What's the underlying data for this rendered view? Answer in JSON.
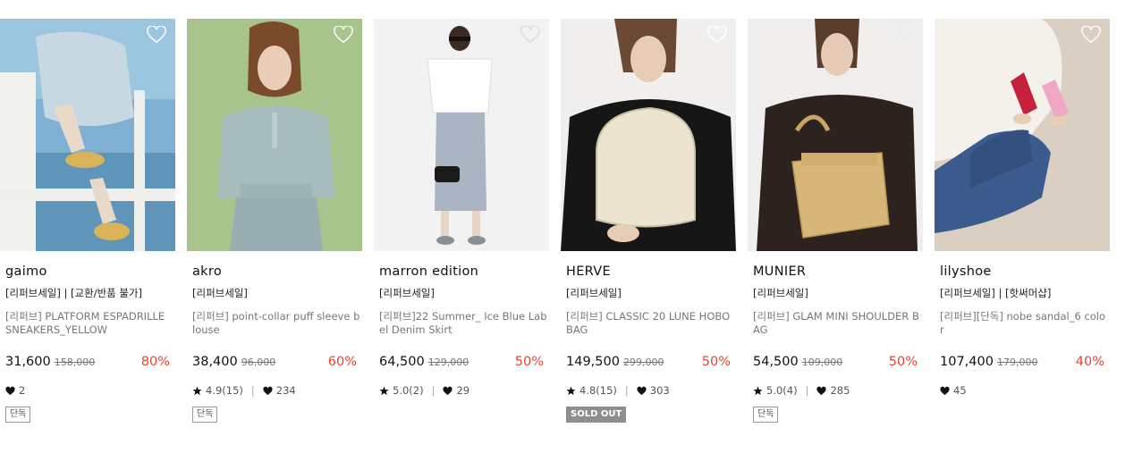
{
  "products": [
    {
      "brand": "gaimo",
      "tag": "[리퍼브세일] | [교환/반품 불가]",
      "name": "[리퍼브] PLATFORM ESPADRILLE SNEAKERS_YELLOW",
      "price": "31,600",
      "original_price": "158,000",
      "discount": "80%",
      "rating": "",
      "likes": "2",
      "badge": "단독",
      "badge_type": "outline",
      "image_icon": "model-in-skirt-and-espadrilles-image",
      "colors": [
        "#7fb7d6",
        "#cfd9e3"
      ]
    },
    {
      "brand": "akro",
      "tag": "[리퍼브세일]",
      "name": "[리퍼브] point-collar puff sleeve blouse",
      "price": "38,400",
      "original_price": "96,000",
      "discount": "60%",
      "rating": "4.9(15)",
      "likes": "234",
      "badge": "단독",
      "badge_type": "outline",
      "image_icon": "model-in-striped-blouse-image",
      "colors": [
        "#a9c48a",
        "#9fb7b8"
      ]
    },
    {
      "brand": "marron edition",
      "tag": "[리퍼브세일]",
      "name": "[리퍼브]22 Summer_ Ice Blue Label Denim Skirt",
      "price": "64,500",
      "original_price": "129,000",
      "discount": "50%",
      "rating": "5.0(2)",
      "likes": "29",
      "badge": "",
      "badge_type": "none",
      "image_icon": "model-in-denim-skirt-image",
      "colors": [
        "#f2f2f2",
        "#a8b2c0"
      ]
    },
    {
      "brand": "HERVE",
      "tag": "[리퍼브세일]",
      "name": "[리퍼브] CLASSIC 20 LUNE HOBO BAG",
      "price": "149,500",
      "original_price": "299,000",
      "discount": "50%",
      "rating": "4.8(15)",
      "likes": "303",
      "badge": "SOLD OUT",
      "badge_type": "sold",
      "image_icon": "model-with-cream-hobo-bag-image",
      "colors": [
        "#1a1a1a",
        "#ebe3cf"
      ]
    },
    {
      "brand": "MUNIER",
      "tag": "[리퍼브세일]",
      "name": "[리퍼브] GLAM MINI SHOULDER BAG",
      "price": "54,500",
      "original_price": "109,000",
      "discount": "50%",
      "rating": "5.0(4)",
      "likes": "285",
      "badge": "단독",
      "badge_type": "outline",
      "image_icon": "model-with-tan-shoulder-bag-image",
      "colors": [
        "#2e2420",
        "#d9b77a"
      ]
    },
    {
      "brand": "lilyshoe",
      "tag": "[리퍼브세일] | [핫써머샵]",
      "name": "[리퍼브][단독] nobe sandal_6 color",
      "price": "107,400",
      "original_price": "179,000",
      "discount": "40%",
      "rating": "",
      "likes": "45",
      "badge": "",
      "badge_type": "none",
      "image_icon": "model-in-jeans-with-sandals-image",
      "colors": [
        "#f3efe8",
        "#3c5a8a"
      ]
    }
  ]
}
